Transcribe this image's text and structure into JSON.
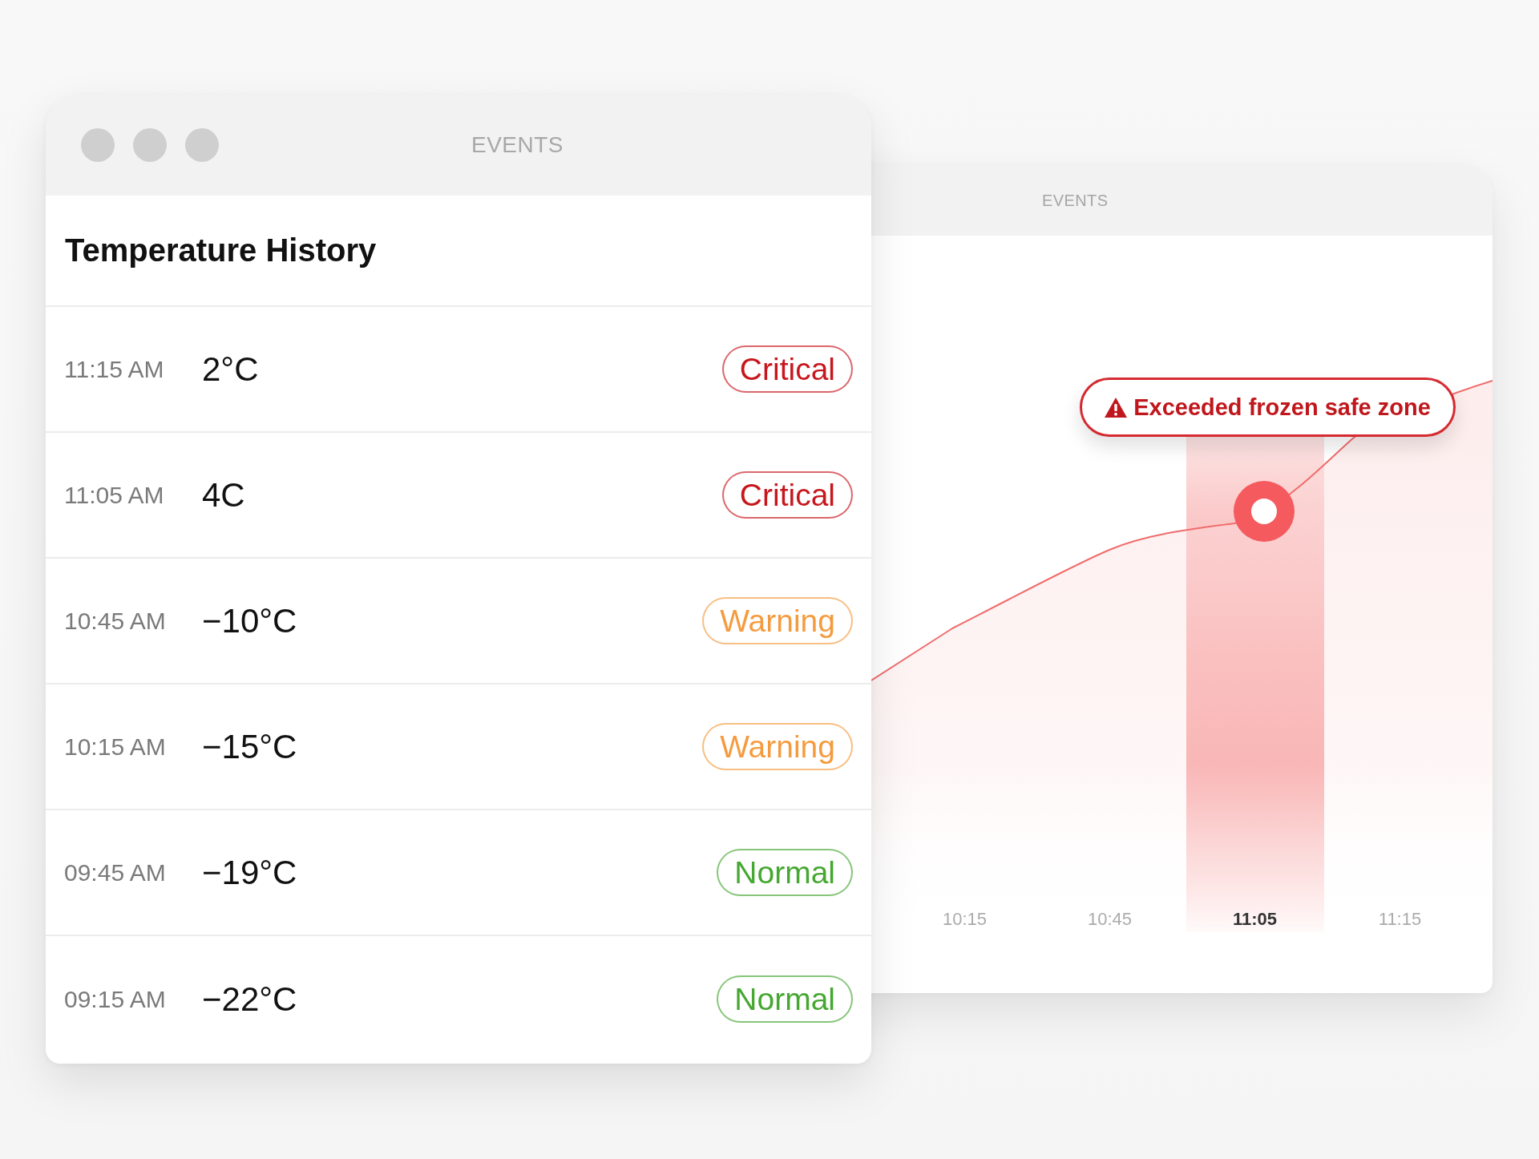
{
  "front_window": {
    "title": "EVENTS",
    "heading": "Temperature History",
    "rows": [
      {
        "time": "11:15 AM",
        "temperature": "2°C",
        "status": {
          "label": "Critical",
          "color": "#c8161d"
        }
      },
      {
        "time": "11:05 AM",
        "temperature": "4C",
        "status": {
          "label": "Critical",
          "color": "#c8161d"
        }
      },
      {
        "time": "10:45 AM",
        "temperature": "−10°C",
        "status": {
          "label": "Warning",
          "color": "#f59b3f"
        }
      },
      {
        "time": "10:15 AM",
        "temperature": "−15°C",
        "status": {
          "label": "Warning",
          "color": "#f59b3f"
        }
      },
      {
        "time": "09:45 AM",
        "temperature": "−19°C",
        "status": {
          "label": "Normal",
          "color": "#46a832"
        }
      },
      {
        "time": "09:15 AM",
        "temperature": "−22°C",
        "status": {
          "label": "Normal",
          "color": "#46a832"
        }
      }
    ]
  },
  "back_window": {
    "title": "EVENTS",
    "chart": {
      "alert": {
        "text": "Exceeded frozen safe zone"
      },
      "x_labels": [
        {
          "label": "10:15",
          "selected": false
        },
        {
          "label": "10:45",
          "selected": false
        },
        {
          "label": "11:05",
          "selected": true
        },
        {
          "label": "11:15",
          "selected": false
        }
      ]
    }
  }
}
